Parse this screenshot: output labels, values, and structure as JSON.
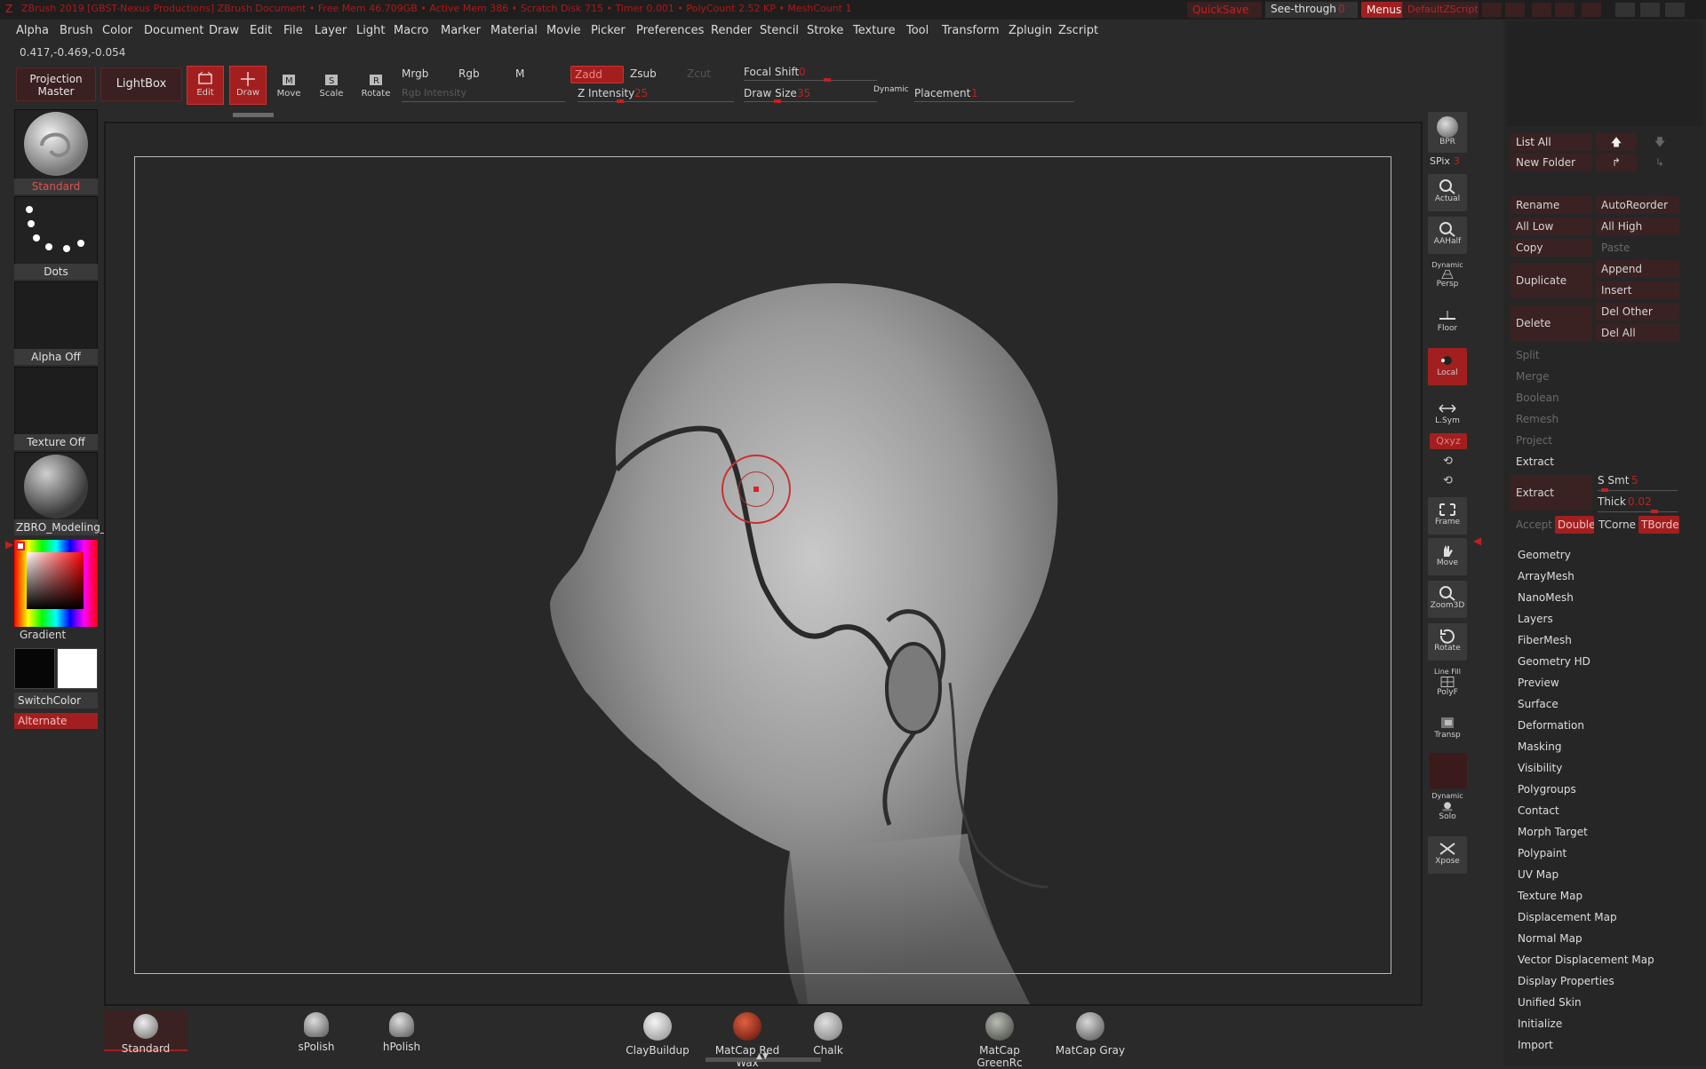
{
  "titlebar": {
    "title": "ZBrush 2019 [GBST-Nexus Productions] ZBrush Document  • Free Mem 46.709GB • Active Mem 386 • Scratch Disk 715 • Timer 0.001 • PolyCount 2.52 KP • MeshCount 1",
    "quicksave": "QuickSave",
    "see_through_label": "See-through",
    "see_through_value": "0",
    "menus": "Menus",
    "default_zscript": "DefaultZScript"
  },
  "menubar": [
    "Alpha",
    "Brush",
    "Color",
    "Document",
    "Draw",
    "Edit",
    "File",
    "Layer",
    "Light",
    "Macro",
    "Marker",
    "Material",
    "Movie",
    "Picker",
    "Preferences",
    "Render",
    "Stencil",
    "Stroke",
    "Texture",
    "Tool",
    "Transform",
    "Zplugin",
    "Zscript"
  ],
  "coords": "0.417,-0.469,-0.054",
  "toolbar": {
    "projection_master": "Projection Master",
    "lightbox": "LightBox",
    "edit": "Edit",
    "draw": "Draw",
    "move": "Move",
    "scale": "Scale",
    "rotate": "Rotate",
    "mrgb": "Mrgb",
    "rgb": "Rgb",
    "m": "M",
    "rgb_intensity": "Rgb Intensity",
    "zadd": "Zadd",
    "zsub": "Zsub",
    "zcut": "Zcut",
    "z_intensity_label": "Z Intensity",
    "z_intensity_value": "25",
    "focal_shift_label": "Focal Shift",
    "focal_shift_value": "0",
    "draw_size_label": "Draw Size",
    "draw_size_value": "35",
    "dynamic": "Dynamic",
    "placement_label": "Placement",
    "placement_value": "1"
  },
  "leftshelf": {
    "brush": "Standard",
    "stroke": "Dots",
    "alpha": "Alpha Off",
    "texture": "Texture Off",
    "material": "ZBRO_Modeling_",
    "gradient": "Gradient",
    "switchcolor": "SwitchColor",
    "alternate": "Alternate"
  },
  "rightshelf": {
    "bpr": "BPR",
    "spix_label": "SPix",
    "spix_value": "3",
    "actual": "Actual",
    "aahalf": "AAHalf",
    "dynamic": "Dynamic",
    "persp": "Persp",
    "floor": "Floor",
    "local": "Local",
    "lsym": "L.Sym",
    "xyz": "Qxyz",
    "frame": "Frame",
    "move": "Move",
    "zoom3d": "Zoom3D",
    "rotate": "Rotate",
    "linefill": "Line Fill",
    "polyf": "PolyF",
    "transp": "Transp",
    "dynamic2": "Dynamic",
    "solo": "Solo",
    "xpose": "Xpose"
  },
  "subtool": {
    "list_all": "List All",
    "new_folder": "New Folder",
    "rename": "Rename",
    "autoreorder": "AutoReorder",
    "all_low": "All Low",
    "all_high": "All High",
    "copy": "Copy",
    "paste": "Paste",
    "duplicate": "Duplicate",
    "append": "Append",
    "insert": "Insert",
    "delete": "Delete",
    "del_other": "Del Other",
    "del_all": "Del All",
    "split": "Split",
    "merge": "Merge",
    "boolean": "Boolean",
    "remesh": "Remesh",
    "project": "Project",
    "extract_header": "Extract",
    "extract": "Extract",
    "s_smt_label": "S Smt",
    "s_smt_value": "5",
    "thick_label": "Thick",
    "thick_value": "0.02",
    "accept": "Accept",
    "double": "Double",
    "tcorne": "TCorne",
    "tborde": "TBorde",
    "menus": [
      "Geometry",
      "ArrayMesh",
      "NanoMesh",
      "Layers",
      "FiberMesh",
      "Geometry HD",
      "Preview",
      "Surface",
      "Deformation",
      "Masking",
      "Visibility",
      "Polygroups",
      "Contact",
      "Morph Target",
      "Polypaint",
      "UV Map",
      "Texture Map",
      "Displacement Map",
      "Normal Map",
      "Vector Displacement Map",
      "Display Properties",
      "Unified Skin",
      "Initialize",
      "Import"
    ]
  },
  "bottomshelf": [
    "Standard",
    "sPolish",
    "hPolish",
    "ClayBuildup",
    "MatCap Red Wax",
    "Chalk",
    "MatCap GreenRc",
    "MatCap Gray"
  ]
}
